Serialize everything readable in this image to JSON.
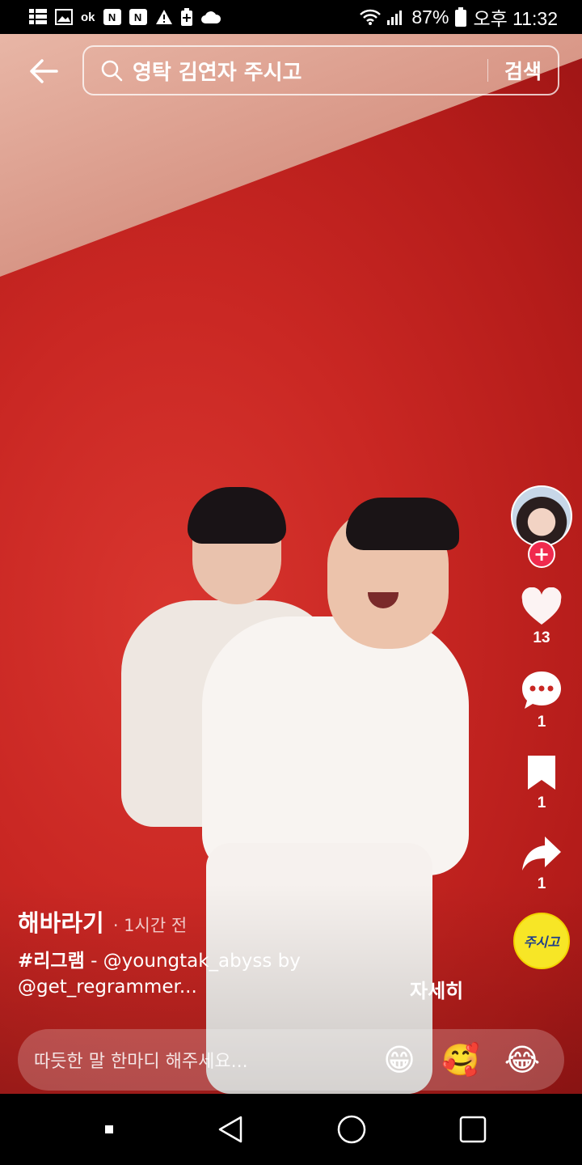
{
  "status": {
    "left_icons": [
      "grid-icon",
      "gallery-icon",
      "ok-icon",
      "naver-icon",
      "naver-icon",
      "warning-icon",
      "battery-saver-icon",
      "cloud-icon"
    ],
    "ok_text": "ok",
    "n_text": "N",
    "battery": "87%",
    "time": "오후 11:32"
  },
  "search": {
    "query": "영탁 김연자 주시고",
    "button": "검색"
  },
  "rail": {
    "likes": "13",
    "comments": "1",
    "bookmarks": "1",
    "shares": "1",
    "follow_symbol": "+",
    "music_label": "주시고"
  },
  "post": {
    "author": "해바라기",
    "time": "· 1시간 전",
    "hashtag": "#리그램",
    "text_line1": " - @youngtak_abyss by",
    "text_line2": "@get_regrammer...",
    "more": "자세히"
  },
  "comment": {
    "placeholder": "따듯한 말 한마디 해주세요...",
    "emojis": [
      "😁",
      "🥰",
      "😂"
    ]
  },
  "colors": {
    "accent": "#f02a4e",
    "background_red": "#c92723"
  }
}
